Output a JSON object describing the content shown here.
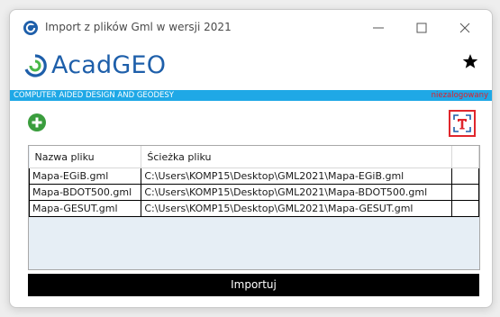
{
  "window": {
    "title": "Import z plików Gml w wersji 2021"
  },
  "brand": {
    "logo_text": "AcadGEO",
    "tagline": "COMPUTER AIDED DESIGN AND GEODESY",
    "login_status": "niezalogowany",
    "accent_color": "#1fa8e6",
    "status_color": "#e0202a"
  },
  "toolbar": {
    "add_icon": "add-circle-icon",
    "text_tool_icon": "text-frame-icon",
    "favorite_icon": "star-icon"
  },
  "table": {
    "columns": [
      "Nazwa pliku",
      "Ścieżka pliku"
    ],
    "rows": [
      {
        "name": "Mapa-EGiB.gml",
        "path": "C:\\Users\\KOMP15\\Desktop\\GML2021\\Mapa-EGiB.gml"
      },
      {
        "name": "Mapa-BDOT500.gml",
        "path": "C:\\Users\\KOMP15\\Desktop\\GML2021\\Mapa-BDOT500.gml"
      },
      {
        "name": "Mapa-GESUT.gml",
        "path": "C:\\Users\\KOMP15\\Desktop\\GML2021\\Mapa-GESUT.gml"
      }
    ]
  },
  "actions": {
    "import_label": "Importuj"
  }
}
